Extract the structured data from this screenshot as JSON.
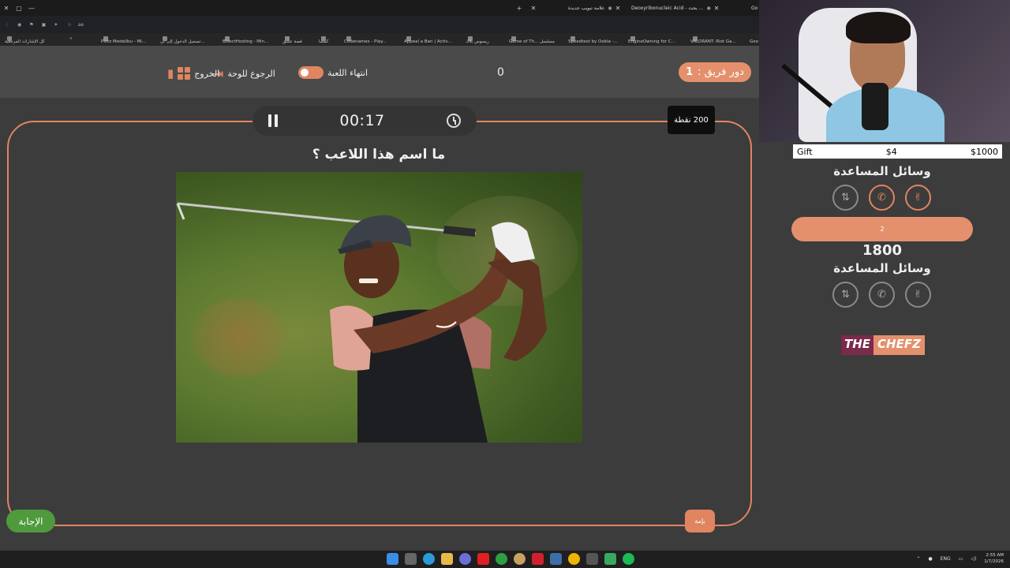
{
  "browser": {
    "tabs": [
      {
        "label": "علامة تبويب جديدة"
      },
      {
        "label": "Deoxyribonucleic Acid - بحث ..."
      },
      {
        "label": "Go"
      }
    ],
    "address": "ae"
  },
  "bookmarks": [
    "كل الإشارات المرجعية",
    "Plotz Modellbu - Mi...",
    "تسجيل الدخول إلى ني...",
    "BisectHosting - Min...",
    "قصة عشق",
    "كمشا",
    "Codenames - Play...",
    "Appeal a Ban | Activ...",
    "ريسوس بلاك",
    "Game of Th... مسلسل",
    "Speedtest by Ookla -...",
    "EngineOwning for C...",
    "VALORANT: Riot Ga...",
    "Goo"
  ],
  "game": {
    "turn_label": "دور فريق :",
    "turn_team": "1",
    "center_score": "0",
    "end_game_label": "انتهاء اللعبة",
    "back_to_board_label": "الرجوع للوحة",
    "exit_label": "الخروج",
    "timer": "00:17",
    "points_badge": "200 نقطة",
    "question": "ما اسم هذا اللاعب ؟",
    "answer_button": "الإجابة",
    "skip_button": "بإمة"
  },
  "panel": {
    "gift_label": "Gift",
    "gift_amount": "$4",
    "gift_goal": "$1000",
    "team1_aids_label": "وسائل المساعدة",
    "team2_bar": "2",
    "team2_score": "1800",
    "team2_aids_label": "وسائل المساعدة",
    "sponsor_part1": "THE",
    "sponsor_part2": "CHEFZ"
  },
  "taskbar": {
    "lang": "ENG",
    "time": "2:55 AM",
    "date": "1/7/2026"
  },
  "colors": {
    "accent": "#e08560",
    "answer": "#4e9a3c",
    "background": "#3c3c3c"
  }
}
